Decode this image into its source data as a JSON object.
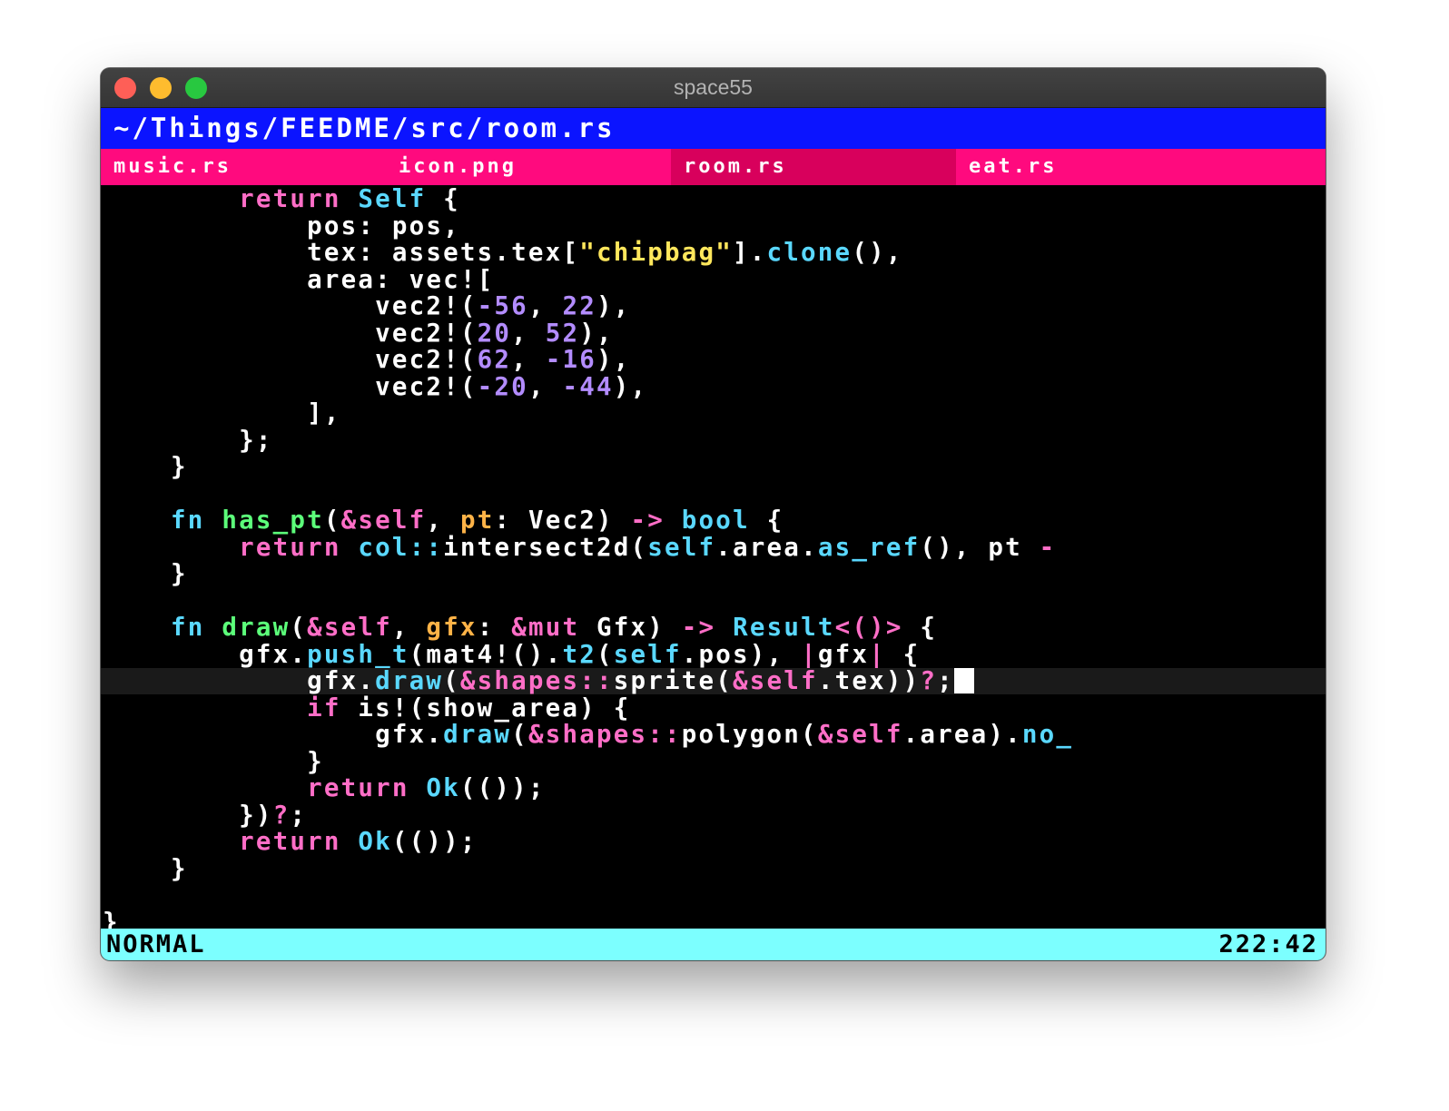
{
  "window": {
    "title": "space55"
  },
  "path": "~/Things/FEEDME/src/room.rs",
  "tabs": [
    {
      "label": "music.rs"
    },
    {
      "label": "icon.png"
    },
    {
      "label": "room.rs",
      "active": true
    },
    {
      "label": "eat.rs"
    }
  ],
  "status": {
    "mode": "NORMAL",
    "position": "222:42"
  },
  "code": {
    "l0": {
      "k1": "return",
      "t1": "Self",
      "r1": " {"
    },
    "l1": {
      "r1": "pos: pos,"
    },
    "l2": {
      "r1": "tex: assets.tex[",
      "s1": "\"chipbag\"",
      "r2": "].",
      "t1": "clone",
      "r3": "(),"
    },
    "l3": {
      "r1": "area: vec!["
    },
    "l4": {
      "r1": "vec2!(",
      "n1": "-56",
      "r2": ", ",
      "n2": "22",
      "r3": "),"
    },
    "l5": {
      "r1": "vec2!(",
      "n1": "20",
      "r2": ", ",
      "n2": "52",
      "r3": "),"
    },
    "l6": {
      "r1": "vec2!(",
      "n1": "62",
      "r2": ", ",
      "n2": "-16",
      "r3": "),"
    },
    "l7": {
      "r1": "vec2!(",
      "n1": "-20",
      "r2": ", ",
      "n2": "-44",
      "r3": "),"
    },
    "l8": {
      "r1": "],"
    },
    "l9": {
      "r1": "};"
    },
    "l10": {
      "r1": "}"
    },
    "l12": {
      "t1": "fn",
      "f1": "has_pt",
      "r1": "(",
      "k1": "&self",
      "r2": ", ",
      "p1": "pt",
      "r3": ": Vec2) ",
      "k2": "->",
      "r4": " ",
      "t2": "bool",
      "r5": " {"
    },
    "l13": {
      "k1": "return",
      "r1": " ",
      "t1": "col::",
      "r2": "intersect2d(",
      "t2": "self",
      "r3": ".area.",
      "t3": "as_ref",
      "r4": "(), pt ",
      "k2": "-"
    },
    "l14": {
      "r1": "}"
    },
    "l16": {
      "t1": "fn",
      "f1": "draw",
      "r1": "(",
      "k1": "&self",
      "r2": ", ",
      "p1": "gfx",
      "r3": ": ",
      "k2": "&mut",
      "r4": " Gfx) ",
      "k3": "->",
      "r5": " ",
      "t2": "Result",
      "k4": "<()>",
      "r6": " {"
    },
    "l17": {
      "r1": "gfx.",
      "t1": "push_t",
      "r2": "(mat4!().",
      "t2": "t2",
      "r3": "(",
      "t3": "self",
      "r4": ".pos), ",
      "k1": "|",
      "r5": "gfx",
      "k2": "|",
      "r6": " {"
    },
    "l18": {
      "r1": "gfx.",
      "t1": "draw",
      "r2": "(",
      "k1": "&shapes::",
      "r3": "sprite(",
      "k2": "&self",
      "r4": ".tex))",
      "k3": "?",
      "r5": ";"
    },
    "l19": {
      "k1": "if",
      "r1": " is!(show_area) {"
    },
    "l20": {
      "r1": "gfx.",
      "t1": "draw",
      "r2": "(",
      "k1": "&shapes::",
      "r3": "polygon(",
      "k2": "&self",
      "r4": ".area).",
      "t2": "no_"
    },
    "l21": {
      "r1": "}"
    },
    "l22": {
      "k1": "return",
      "r1": " ",
      "t1": "Ok",
      "r2": "(());"
    },
    "l23": {
      "r1": "})",
      "k1": "?",
      "r2": ";"
    },
    "l24": {
      "k1": "return",
      "r1": " ",
      "t1": "Ok",
      "r2": "(());"
    },
    "l25": {
      "r1": "}"
    },
    "l27": {
      "r1": "}"
    }
  }
}
